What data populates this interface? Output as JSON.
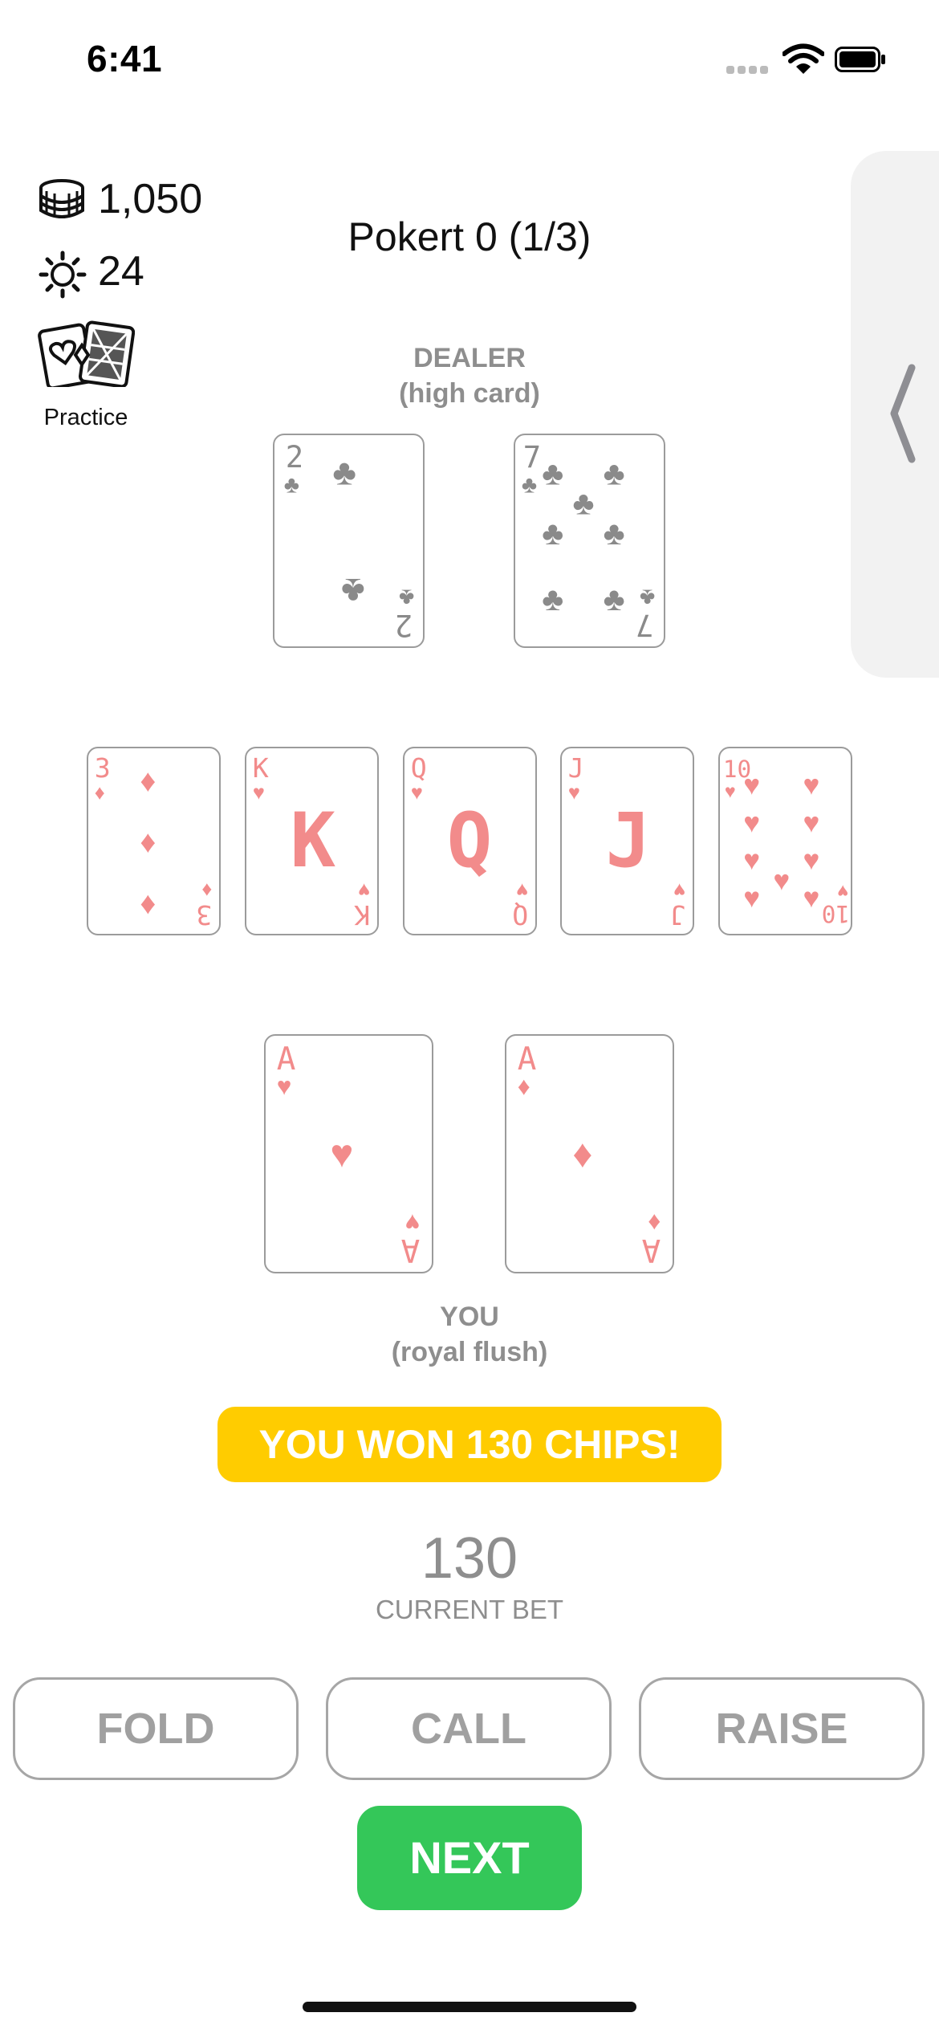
{
  "status_bar": {
    "time": "6:41"
  },
  "stats": {
    "chips": "1,050",
    "suns": "24",
    "mode_label": "Practice"
  },
  "game": {
    "title": "Pokert 0 (1/3)"
  },
  "dealer": {
    "label": "DEALER",
    "hand": "(high card)",
    "cards": [
      {
        "rank": "2",
        "suit": "clubs"
      },
      {
        "rank": "7",
        "suit": "clubs"
      }
    ]
  },
  "board": {
    "cards": [
      {
        "rank": "3",
        "suit": "diamonds"
      },
      {
        "rank": "K",
        "suit": "hearts"
      },
      {
        "rank": "Q",
        "suit": "hearts"
      },
      {
        "rank": "J",
        "suit": "hearts"
      },
      {
        "rank": "10",
        "suit": "hearts"
      }
    ]
  },
  "player": {
    "label": "YOU",
    "hand": "(royal flush)",
    "cards": [
      {
        "rank": "A",
        "suit": "hearts"
      },
      {
        "rank": "A",
        "suit": "diamonds"
      }
    ]
  },
  "result": {
    "banner": "YOU WON 130 CHIPS!"
  },
  "bet": {
    "value": "130",
    "label": "CURRENT BET"
  },
  "actions": {
    "fold": "FOLD",
    "call": "CALL",
    "raise": "RAISE",
    "next": "NEXT"
  },
  "colors": {
    "red_suit": "#f28b8b",
    "black_suit": "#8a8a8a",
    "banner": "#ffcc00",
    "next_button": "#34c759",
    "muted_text": "#8e8e8e"
  }
}
